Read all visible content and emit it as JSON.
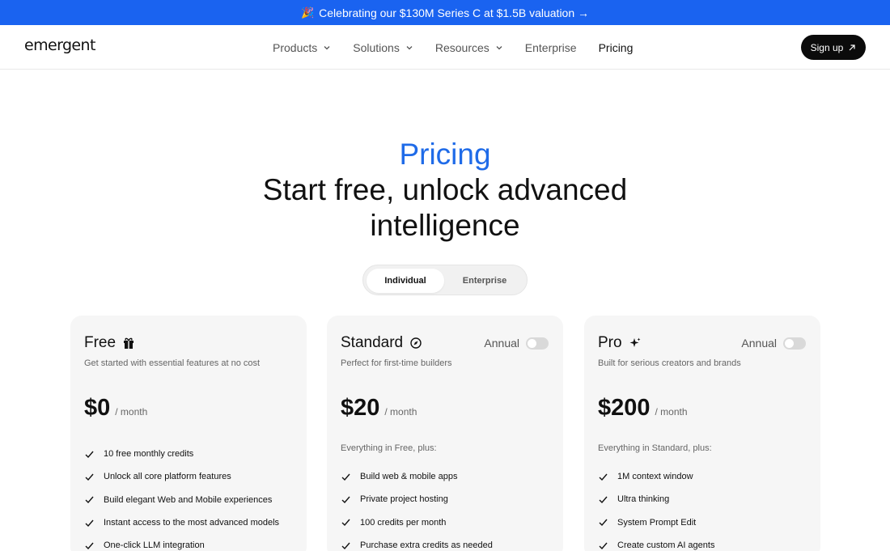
{
  "banner": {
    "emoji": "🎉",
    "text": "Celebrating our $130M Series C at $1.5B valuation →"
  },
  "nav": {
    "logo": "emergent",
    "items": [
      {
        "label": "Products",
        "dropdown": true
      },
      {
        "label": "Solutions",
        "dropdown": true
      },
      {
        "label": "Resources",
        "dropdown": true
      },
      {
        "label": "Enterprise",
        "dropdown": false
      },
      {
        "label": "Pricing",
        "dropdown": false
      }
    ],
    "signup": "Sign up"
  },
  "hero": {
    "kicker": "Pricing",
    "title_line1": "Start free, unlock advanced",
    "title_line2": "intelligence"
  },
  "plan_toggle": {
    "selected": "Individual",
    "other": "Enterprise"
  },
  "plans": [
    {
      "name": "Free",
      "icon": "gift-icon",
      "description": "Get started with essential features at no cost",
      "price": "$0",
      "period": "/ month",
      "features": [
        "10 free monthly credits",
        "Unlock all core platform features",
        "Build elegant Web and Mobile experiences",
        "Instant access to the most advanced models",
        "One-click LLM integration"
      ]
    },
    {
      "name": "Standard",
      "icon": "compass-icon",
      "annual_label": "Annual",
      "description": "Perfect for first-time builders",
      "price": "$20",
      "period": "/ month",
      "includes": "Everything in Free, plus:",
      "features": [
        "Build web & mobile apps",
        "Private project hosting",
        "100 credits per month",
        "Purchase extra credits as needed"
      ]
    },
    {
      "name": "Pro",
      "icon": "sparkle-icon",
      "annual_label": "Annual",
      "description": "Built for serious creators and brands",
      "price": "$200",
      "period": "/ month",
      "includes": "Everything in Standard, plus:",
      "features": [
        "1M context window",
        "Ultra thinking",
        "System Prompt Edit",
        "Create custom AI agents"
      ]
    }
  ],
  "colors": {
    "banner": "#1a63f0",
    "accent": "#1f6be8",
    "dark": "#0b0b0b",
    "card": "#f6f6f6"
  }
}
